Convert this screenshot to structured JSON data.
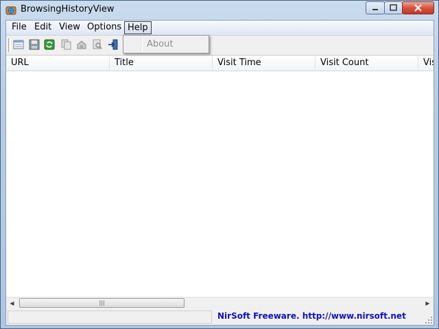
{
  "window": {
    "title": "BrowsingHistoryView"
  },
  "menubar": {
    "items": [
      {
        "label": "File"
      },
      {
        "label": "Edit"
      },
      {
        "label": "View"
      },
      {
        "label": "Options"
      },
      {
        "label": "Help"
      }
    ]
  },
  "help_menu": {
    "items": [
      {
        "label": "About",
        "enabled": false
      }
    ]
  },
  "toolbar": {
    "buttons": [
      {
        "icon": "html-report-icon"
      },
      {
        "icon": "save-icon"
      },
      {
        "icon": "refresh-icon"
      },
      {
        "icon": "copy-icon"
      },
      {
        "icon": "properties-icon"
      },
      {
        "icon": "find-icon"
      },
      {
        "icon": "exit-icon"
      }
    ]
  },
  "list": {
    "columns": [
      {
        "label": "URL"
      },
      {
        "label": "Title"
      },
      {
        "label": "Visit Time"
      },
      {
        "label": "Visit Count"
      },
      {
        "label": "Vis"
      }
    ],
    "rows": []
  },
  "statusbar": {
    "link_text": "NirSoft Freeware.  http://www.nirsoft.net"
  },
  "colors": {
    "link": "#1010c0",
    "close_button": "#c5362a"
  }
}
